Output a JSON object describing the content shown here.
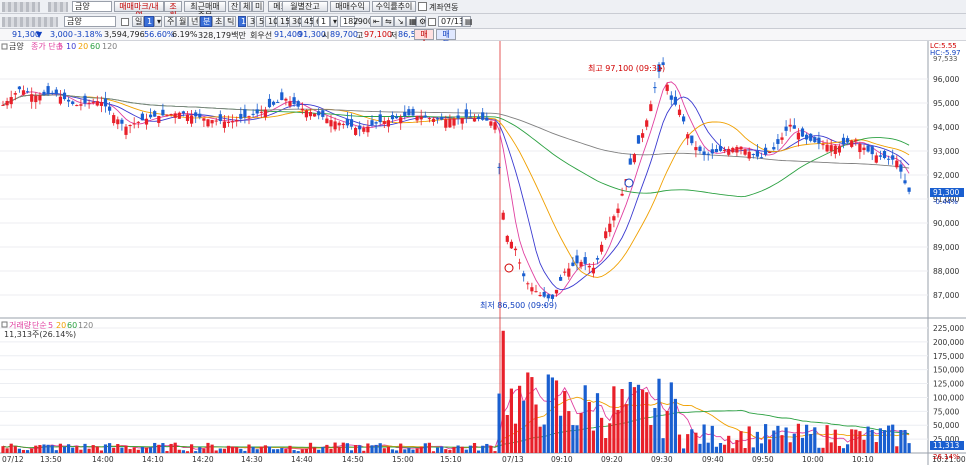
{
  "toolbar": {
    "name_field": "금양",
    "tab_manage": "매매마크/내역",
    "tab_query": "조회",
    "btn_recent": "최근매매종목",
    "btn_trade": "잔",
    "btn_book": "체",
    "btn_mi": "미",
    "btn_memo": "메모보기",
    "btn_monthly": "월별잔고",
    "btn_profit": "매매수익",
    "btn_rate": "수익률추이",
    "chk_account": "계좌연동",
    "period_day": "일",
    "period_week": "주",
    "period_month": "월",
    "period_year": "년",
    "period_min": "분",
    "period_sec": "초",
    "period_tick": "틱",
    "intervals": [
      "1",
      "3",
      "5",
      "10",
      "15",
      "30",
      "45",
      "60"
    ],
    "interval_value": "1",
    "count_value": "182",
    "count_total": "/900",
    "date_value": "07/13"
  },
  "quote": {
    "price": "91,300",
    "change": "3,000",
    "rate": "-3.18%",
    "volume": "3,594,796",
    "vol_rate": "56.60%",
    "turnover_rate": "6.19%",
    "amount": "328,179백만",
    "ticker_name": "회우선",
    "open_label": "시",
    "open": "89,700",
    "high_label": "고",
    "high": "97,100",
    "low_label": "저",
    "low": "86,500",
    "ref_price": "91,400",
    "ref_price2": "91,300",
    "buy_btn": "매수",
    "sell_btn": "매도"
  },
  "colors": {
    "up": "#e8202a",
    "down": "#1a5fd0",
    "ma5": "#e040a0",
    "ma10": "#3a3ad0",
    "ma20": "#f0a000",
    "ma60": "#2aa040",
    "ma120": "#808080"
  },
  "chart_data": [
    {
      "type": "candlestick",
      "legend": [
        "금양",
        "종가 단순",
        "5",
        "10",
        "20",
        "60",
        "120"
      ],
      "y_ticks": [
        "96,000",
        "95,000",
        "94,000",
        "93,000",
        "92,000",
        "91,000",
        "90,000",
        "89,000",
        "88,000",
        "87,000"
      ],
      "ylim": [
        86500,
        97500
      ],
      "annotation_high": "최고 97,100 (09:31)",
      "annotation_low": "최저 86,500 (09:09)",
      "lc": "LC:5.55",
      "hc": "HC:-5.97",
      "current_price_label": "91,300",
      "current_change_label": "-0.44%",
      "top_label": "97,533"
    },
    {
      "type": "bar",
      "legend": [
        "거래량",
        "단순",
        "5",
        "20",
        "60",
        "120"
      ],
      "sub_label": "11,313주(26.14%)",
      "y_ticks": [
        "225,000",
        "200,000",
        "175,000",
        "150,000",
        "125,000",
        "100,000",
        "75,000",
        "50,000",
        "25,000"
      ],
      "ylim": [
        0,
        225000
      ],
      "current_volume_label": "11,313",
      "current_rate_label": "26.14%"
    }
  ],
  "x_axis": [
    "07/12",
    "13:50",
    "14:00",
    "14:10",
    "14:20",
    "14:30",
    "14:40",
    "14:50",
    "15:00",
    "15:10",
    "07/13",
    "09:10",
    "09:20",
    "09:30",
    "09:40",
    "09:50",
    "10:00",
    "10:10",
    "10:21:00"
  ]
}
